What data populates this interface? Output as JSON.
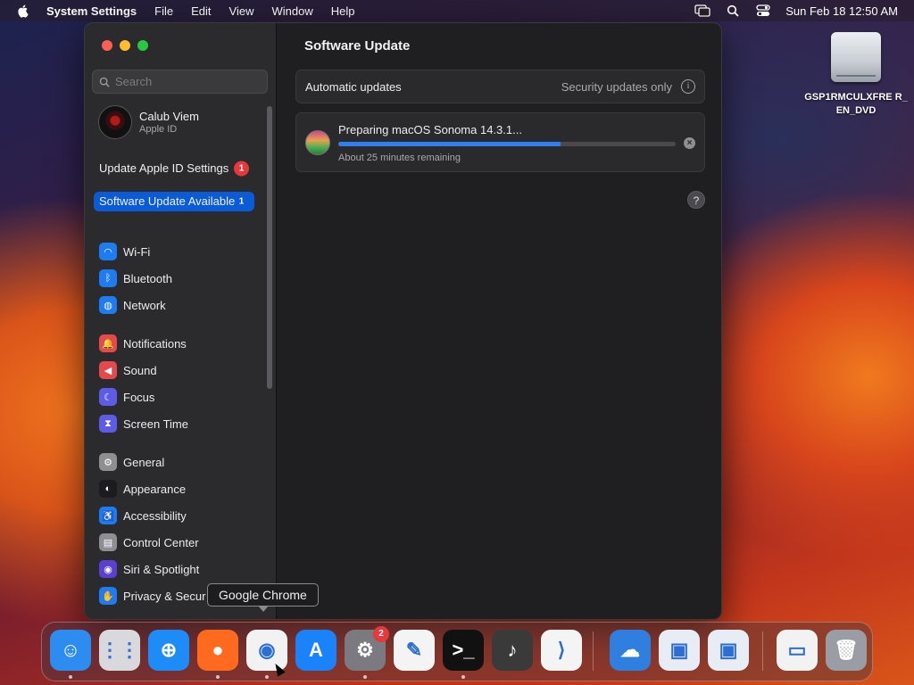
{
  "menubar": {
    "app_name": "System Settings",
    "menus": [
      "File",
      "Edit",
      "View",
      "Window",
      "Help"
    ],
    "clock": "Sun Feb 18  12:50 AM"
  },
  "desktop": {
    "drive_label": "GSP1RMCULXFRE R_EN_DVD"
  },
  "sidebar": {
    "search_placeholder": "Search",
    "account_name": "Calub Viem",
    "account_sub": "Apple ID",
    "alerts": [
      {
        "label": "Update Apple ID Settings",
        "badge": "1"
      },
      {
        "label": "Software Update Available",
        "badge": "1"
      }
    ],
    "items": [
      {
        "label": "Wi-Fi",
        "icon": "wifi-icon",
        "color": "#1e7bf2"
      },
      {
        "label": "Bluetooth",
        "icon": "bluetooth-icon",
        "color": "#1e7bf2"
      },
      {
        "label": "Network",
        "icon": "globe-icon",
        "color": "#1e7bf2"
      },
      {
        "label": "Notifications",
        "icon": "bell-icon",
        "color": "#e5484d"
      },
      {
        "label": "Sound",
        "icon": "speaker-icon",
        "color": "#e5484d"
      },
      {
        "label": "Focus",
        "icon": "moon-icon",
        "color": "#5e5ce6"
      },
      {
        "label": "Screen Time",
        "icon": "hourglass-icon",
        "color": "#5e5ce6"
      },
      {
        "label": "General",
        "icon": "gear-icon",
        "color": "#8e8e93"
      },
      {
        "label": "Appearance",
        "icon": "appearance-icon",
        "color": "#1c1c1e"
      },
      {
        "label": "Accessibility",
        "icon": "accessibility-icon",
        "color": "#1e7bf2"
      },
      {
        "label": "Control Center",
        "icon": "control-center-icon",
        "color": "#8e8e93"
      },
      {
        "label": "Siri & Spotlight",
        "icon": "siri-icon",
        "color": "#5b3fd1"
      },
      {
        "label": "Privacy & Secur",
        "icon": "hand-icon",
        "color": "#1e7bf2"
      }
    ]
  },
  "main": {
    "title": "Software Update",
    "automatic_label": "Automatic updates",
    "automatic_value": "Security updates only",
    "update_title": "Preparing macOS Sonoma 14.3.1...",
    "progress": 0.66,
    "remaining": "About 25 minutes remaining",
    "help": "?"
  },
  "tooltip": "Google Chrome",
  "dock": {
    "items": [
      {
        "name": "Finder",
        "color": "#2d8cf0",
        "glyph": "☺"
      },
      {
        "name": "Launchpad",
        "color": "#d9d9dd",
        "glyph": "⋮⋮"
      },
      {
        "name": "Safari",
        "color": "#1d8cf8",
        "glyph": "⊕"
      },
      {
        "name": "Firefox",
        "color": "#ff6a1f",
        "glyph": "●"
      },
      {
        "name": "Google Chrome",
        "color": "#f2f2f2",
        "glyph": "◉"
      },
      {
        "name": "App Store",
        "color": "#1a82fb",
        "glyph": "A"
      },
      {
        "name": "System Settings",
        "color": "#7a7a80",
        "glyph": "⚙",
        "badge": "2"
      },
      {
        "name": "TextEdit",
        "color": "#f4f4f4",
        "glyph": "✎"
      },
      {
        "name": "Terminal",
        "color": "#111111",
        "glyph": ">_"
      },
      {
        "name": "GarageBand",
        "color": "#3a3a3a",
        "glyph": "♪"
      },
      {
        "name": "Visual Studio Code",
        "color": "#f4f4f4",
        "glyph": "⟩"
      },
      {
        "name": "Weather",
        "color": "#2f7fe0",
        "glyph": "☁"
      },
      {
        "name": "VirtualBox",
        "color": "#e8ecf4",
        "glyph": "▣"
      },
      {
        "name": "VirtualBox VM",
        "color": "#e8ecf4",
        "glyph": "▣"
      },
      {
        "name": "Downloads",
        "color": "#f2f2f2",
        "glyph": "▭"
      },
      {
        "name": "Trash",
        "color": "#9a9ea4",
        "glyph": "🗑"
      }
    ]
  }
}
